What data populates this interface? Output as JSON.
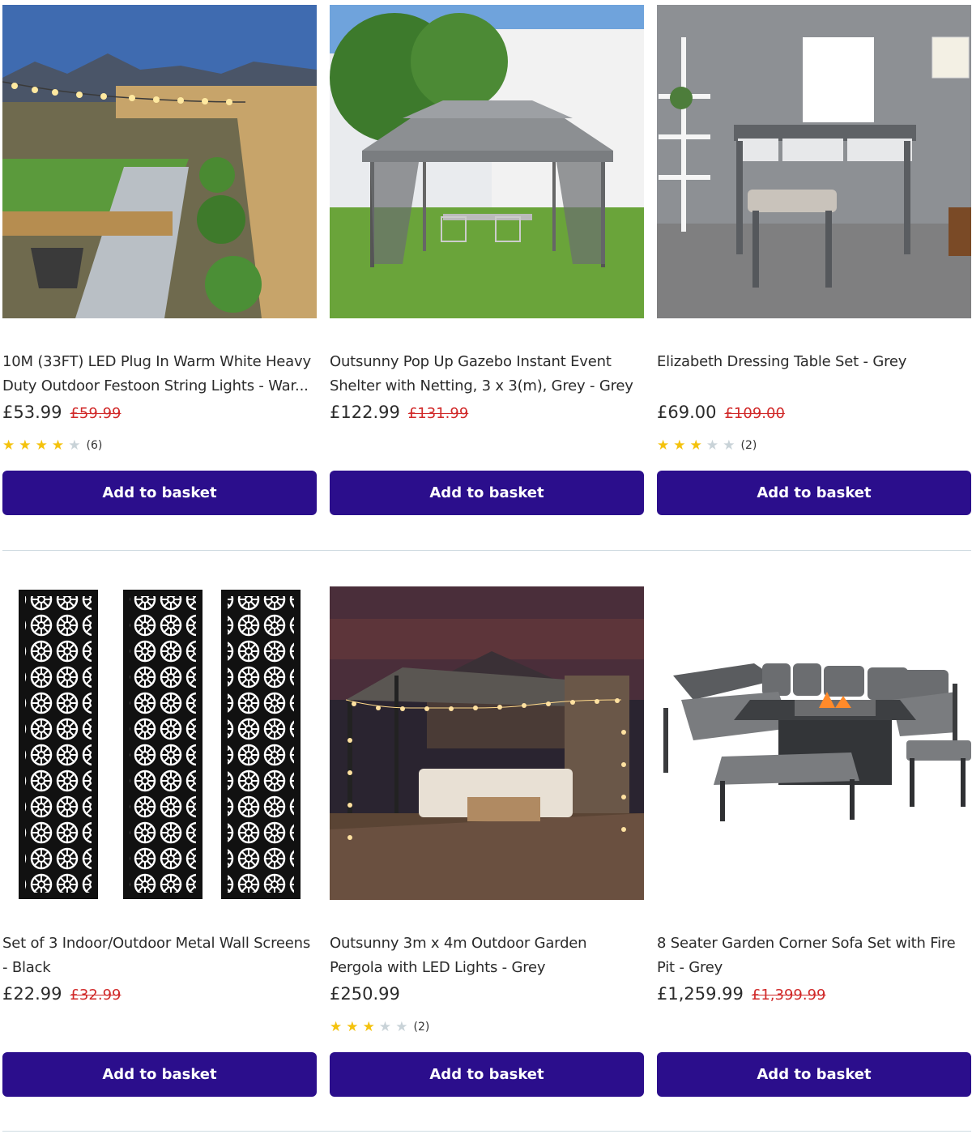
{
  "products": [
    {
      "title": "10M (33FT) LED Plug In Warm White Heavy Duty Outdoor Festoon String Lights - War...",
      "price": "£53.99",
      "was_price": "£59.99",
      "rating": 4,
      "review_count": "(6)",
      "button": "Add to basket"
    },
    {
      "title": "Outsunny Pop Up Gazebo Instant Event Shelter with Netting, 3 x 3(m), Grey - Grey",
      "price": "£122.99",
      "was_price": "£131.99",
      "button": "Add to basket"
    },
    {
      "title": "Elizabeth Dressing Table Set - Grey",
      "price": "£69.00",
      "was_price": "£109.00",
      "rating": 3,
      "review_count": "(2)",
      "button": "Add to basket"
    },
    {
      "title": "Set of 3 Indoor/Outdoor Metal Wall Screens - Black",
      "price": "£22.99",
      "was_price": "£32.99",
      "button": "Add to basket"
    },
    {
      "title": "Outsunny 3m x 4m Outdoor Garden Pergola with LED Lights - Grey",
      "price": "£250.99",
      "rating": 3,
      "review_count": "(2)",
      "button": "Add to basket"
    },
    {
      "title": "8 Seater Garden Corner Sofa Set with Fire Pit - Grey",
      "price": "£1,259.99",
      "was_price": "£1,399.99",
      "button": "Add to basket"
    }
  ],
  "colors": {
    "button_bg": "#2b0e8c",
    "was_price": "#d12a2a",
    "star_on": "#f4c20d",
    "star_off": "#c9d3d8",
    "divider": "#cfdbe1"
  }
}
